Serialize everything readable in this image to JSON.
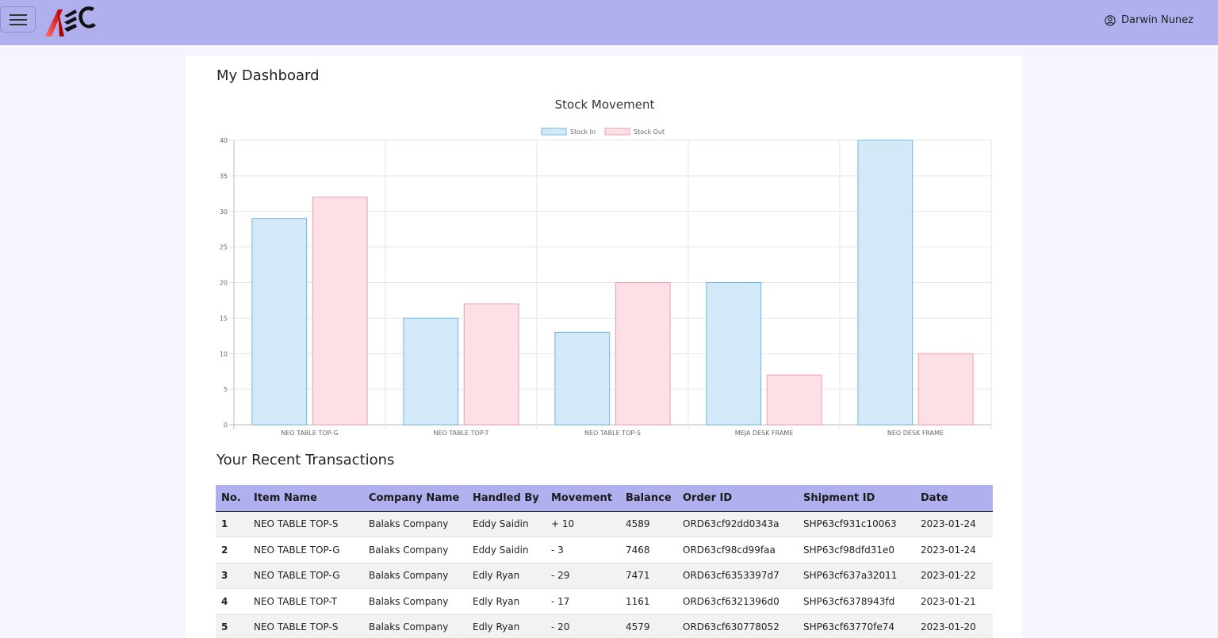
{
  "header": {
    "user_name": "Darwin Nunez",
    "logo_text": "AEC"
  },
  "page": {
    "title": "My Dashboard",
    "transactions_title": "Your Recent Transactions"
  },
  "chart_data": {
    "type": "bar",
    "title": "Stock Movement",
    "categories": [
      "NEO TABLE TOP-G",
      "NEO TABLE TOP-T",
      "NEO TABLE TOP-S",
      "MEJA DESK FRAME",
      "NEO DESK FRAME"
    ],
    "series": [
      {
        "name": "Stock In",
        "values": [
          29,
          15,
          13,
          20,
          40
        ],
        "fill": "#d4e9f8",
        "stroke": "#6fb6e3"
      },
      {
        "name": "Stock Out",
        "values": [
          32,
          17,
          20,
          7,
          10
        ],
        "fill": "#fde0e6",
        "stroke": "#f29bb1"
      }
    ],
    "ylim": [
      0,
      40
    ],
    "yticks": [
      0,
      5,
      10,
      15,
      20,
      25,
      30,
      35,
      40
    ],
    "legend": "top",
    "grid": true
  },
  "table": {
    "headers": [
      "No.",
      "Item Name",
      "Company Name",
      "Handled By",
      "Movement",
      "Balance",
      "Order ID",
      "Shipment ID",
      "Date"
    ],
    "rows": [
      [
        "1",
        "NEO TABLE TOP-S",
        "Balaks Company",
        "Eddy Saidin",
        "+ 10",
        "4589",
        "ORD63cf92dd0343a",
        "SHP63cf931c10063",
        "2023-01-24"
      ],
      [
        "2",
        "NEO TABLE TOP-G",
        "Balaks Company",
        "Eddy Saidin",
        "- 3",
        "7468",
        "ORD63cf98cd99faa",
        "SHP63cf98dfd31e0",
        "2023-01-24"
      ],
      [
        "3",
        "NEO TABLE TOP-G",
        "Balaks Company",
        "Edly Ryan",
        "- 29",
        "7471",
        "ORD63cf6353397d7",
        "SHP63cf637a32011",
        "2023-01-22"
      ],
      [
        "4",
        "NEO TABLE TOP-T",
        "Balaks Company",
        "Edly Ryan",
        "- 17",
        "1161",
        "ORD63cf6321396d0",
        "SHP63cf6378943fd",
        "2023-01-21"
      ],
      [
        "5",
        "NEO TABLE TOP-S",
        "Balaks Company",
        "Edly Ryan",
        "- 20",
        "4579",
        "ORD63cf630778052",
        "SHP63cf63770fe74",
        "2023-01-20"
      ]
    ]
  }
}
